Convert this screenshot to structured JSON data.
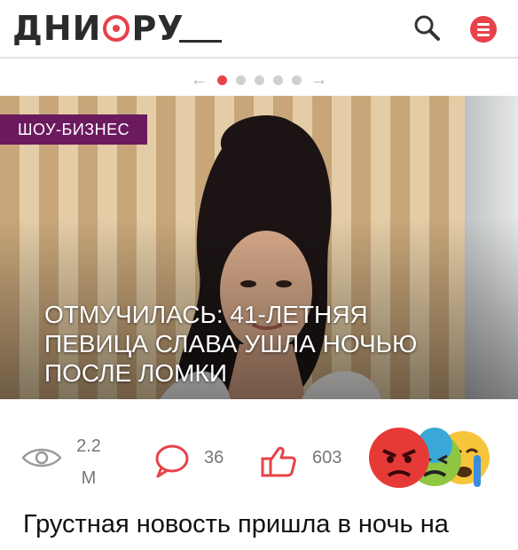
{
  "header": {
    "logo_text": "ДНИ",
    "logo_text_tail": "РУ",
    "brand_color": "#e8424a",
    "search_icon": "search-icon",
    "menu_icon": "menu-icon"
  },
  "carousel": {
    "prev_arrow": "←",
    "next_arrow": "→",
    "dot_count": 5,
    "active_index": 0
  },
  "article": {
    "category": "ШОУ-БИЗНЕС",
    "category_color": "#6b1a5e",
    "headline": "ОТМУЧИЛАСЬ: 41-ЛЕТНЯЯ ПЕВИЦА СЛАВА УШЛА НОЧЬЮ ПОСЛЕ ЛОМКИ",
    "views_line1": "2.2",
    "views_line2": "М",
    "comments": "36",
    "likes": "603",
    "teaser": "Грустная новость пришла в ночь на"
  }
}
